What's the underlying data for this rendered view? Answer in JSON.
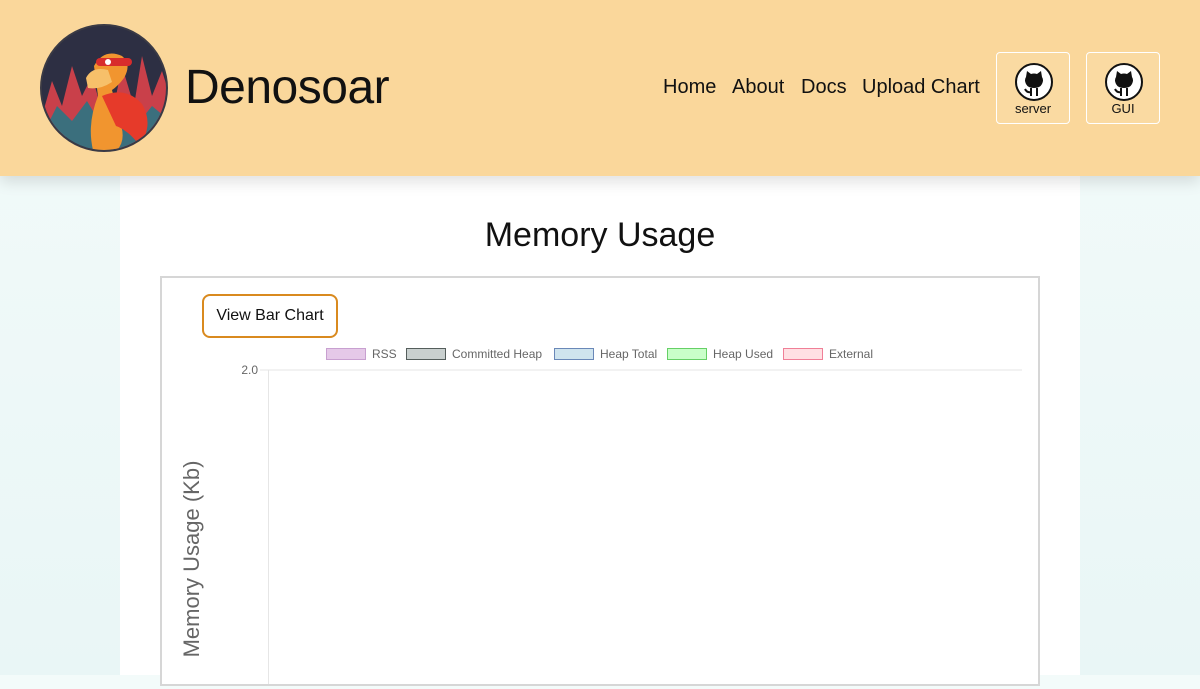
{
  "header": {
    "brand": "Denosoar",
    "nav": [
      "Home",
      "About",
      "Docs",
      "Upload Chart"
    ],
    "github_buttons": [
      {
        "label": "server",
        "icon": "github-icon"
      },
      {
        "label": "GUI",
        "icon": "github-icon"
      }
    ]
  },
  "main": {
    "title": "Memory Usage",
    "toggle_label": "View Bar Chart"
  },
  "chart_data": {
    "type": "line",
    "ylabel": "Memory Usage (Kb)",
    "y_tick_labels": [
      "2.0"
    ],
    "legend_placement": "top-center",
    "grid": true,
    "series": [
      {
        "name": "RSS",
        "values": [],
        "color": "#e5c9e8",
        "border": "#c8a0d0"
      },
      {
        "name": "Committed Heap",
        "values": [],
        "color": "#c9d0cf",
        "border": "#555e5c"
      },
      {
        "name": "Heap Total",
        "values": [],
        "color": "#cfe4ee",
        "border": "#6a88b8"
      },
      {
        "name": "Heap Used",
        "values": [],
        "color": "#c9ffc9",
        "border": "#66d066"
      },
      {
        "name": "External",
        "values": [],
        "color": "#ffe0e3",
        "border": "#f07f97"
      }
    ]
  }
}
